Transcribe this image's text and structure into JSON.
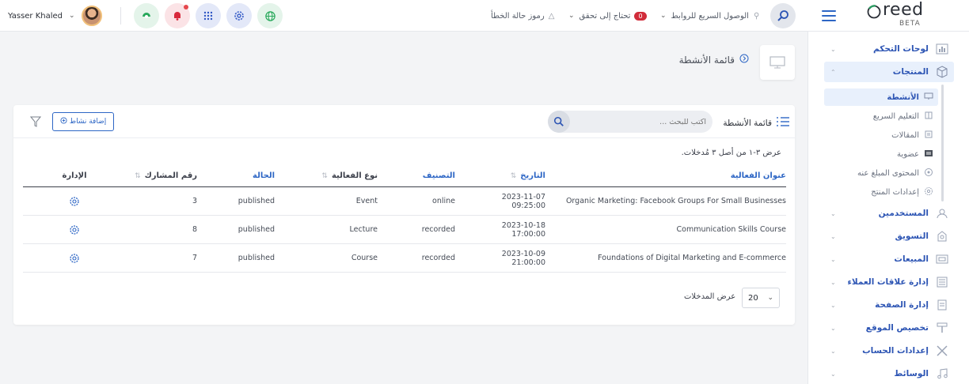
{
  "user": {
    "name": "Yasser Khaled"
  },
  "topbar": {
    "quick_links": "الوصول السريع للروابط",
    "needs_check": "تحتاج إلى تحقق",
    "needs_check_count": "0",
    "error_codes": "رموز حالة الخطأ",
    "icons": [
      "shield-leaf-icon",
      "bell-icon",
      "grid-apps-icon",
      "gear-icon",
      "globe-icon"
    ]
  },
  "logo": {
    "word": "reed",
    "beta": "BETA"
  },
  "page": {
    "title": "قائمة الأنشطة"
  },
  "sidebar": {
    "items": [
      {
        "label": "لوحات التحكم",
        "icon": "chart-icon"
      },
      {
        "label": "المنتجات",
        "icon": "cube-icon"
      },
      {
        "label": "المستخدمين",
        "icon": "users-icon"
      },
      {
        "label": "التسويق",
        "icon": "marketing-icon"
      },
      {
        "label": "المبيعات",
        "icon": "sales-icon"
      },
      {
        "label": "إدارة علاقات العملاء",
        "icon": "crm-icon"
      },
      {
        "label": "إدارة الصفحة",
        "icon": "page-icon"
      },
      {
        "label": "تخصيص الموقع",
        "icon": "paint-roller-icon"
      },
      {
        "label": "إعدادات الحساب",
        "icon": "tools-icon"
      },
      {
        "label": "الوسائط",
        "icon": "music-icon"
      }
    ],
    "subitems": [
      {
        "label": "الأنشطة",
        "icon": "monitor-icon"
      },
      {
        "label": "التعليم السريع",
        "icon": "book-icon"
      },
      {
        "label": "المقالات",
        "icon": "article-icon"
      },
      {
        "label": "عضوية",
        "icon": "card-icon"
      },
      {
        "label": "المحتوى المبلغ عنه",
        "icon": "flag-icon"
      },
      {
        "label": "إعدادات المنتج",
        "icon": "settings-icon"
      }
    ]
  },
  "card": {
    "list_title": "قائمة الأنشطة",
    "search_placeholder": "اكتب للبحث ...",
    "add_button": "إضافة نشاط",
    "summary": "عرض ٣-١ من أصل ٣ مُدخلات."
  },
  "table": {
    "headers": {
      "title": "عنوان الفعالية",
      "date": "التاريخ",
      "classification": "التصنيف",
      "type": "نوع الفعالية",
      "status": "الحالة",
      "participants": "رقم المشارك",
      "admin": "الإدارة"
    },
    "rows": [
      {
        "title": "Organic Marketing: Facebook Groups For Small Businesses",
        "date": "2023-11-07 09:25:00",
        "classification": "online",
        "type": "Event",
        "status": "published",
        "participants": "3"
      },
      {
        "title": "Communication Skills Course",
        "date": "2023-10-18 17:00:00",
        "classification": "recorded",
        "type": "Lecture",
        "status": "published",
        "participants": "8"
      },
      {
        "title": "Foundations of Digital Marketing and E-commerce",
        "date": "2023-10-09 21:00:00",
        "classification": "recorded",
        "type": "Course",
        "status": "published",
        "participants": "7"
      }
    ]
  },
  "pagination": {
    "label": "عرض المدخلات",
    "page_size": "20"
  },
  "colors": {
    "accent": "#2d66c5",
    "badge": "#d12c3a"
  }
}
